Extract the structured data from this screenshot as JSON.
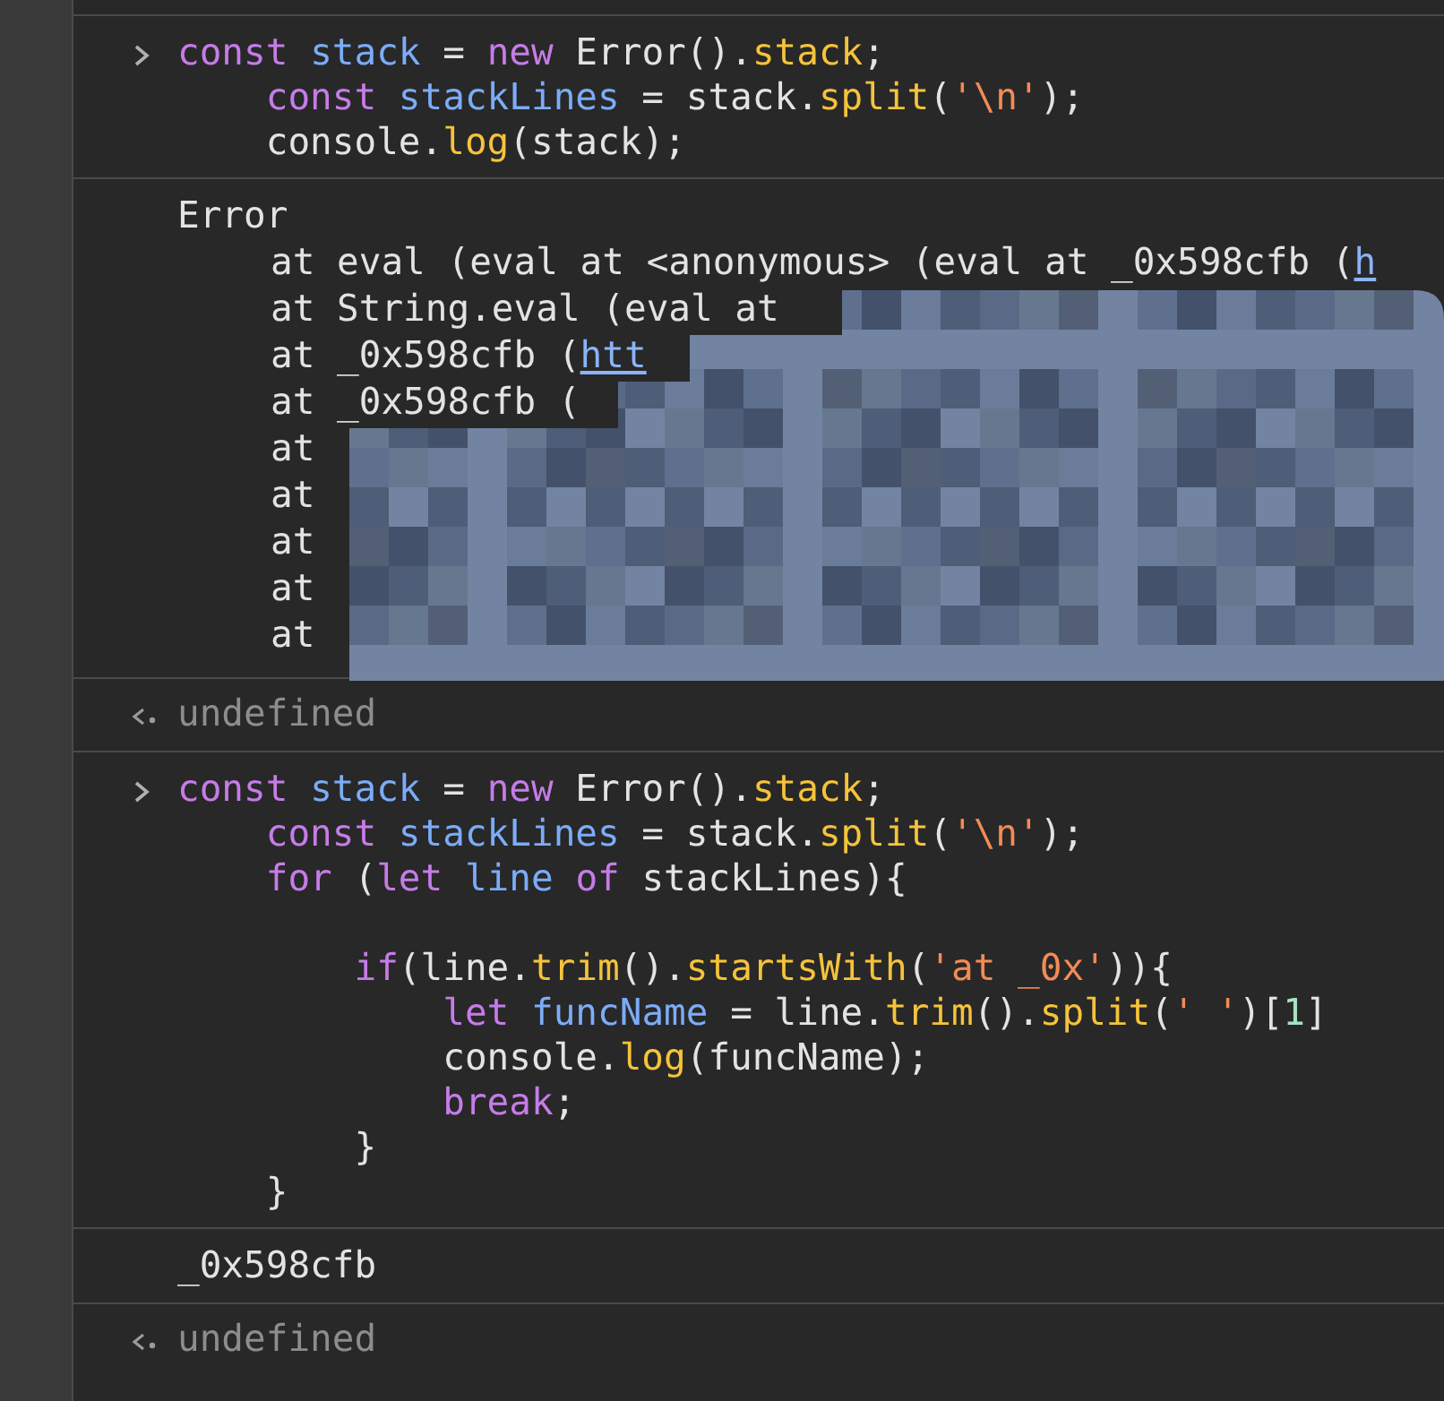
{
  "console": {
    "entries": [
      {
        "kind": "input",
        "lines": [
          {
            "tokens": [
              {
                "kind": "keyword",
                "text": "const "
              },
              {
                "kind": "variable",
                "text": "stack"
              },
              {
                "kind": "plain",
                "text": " = "
              },
              {
                "kind": "keyword",
                "text": "new"
              },
              {
                "kind": "plain",
                "text": " Error()."
              },
              {
                "kind": "function",
                "text": "stack"
              },
              {
                "kind": "plain",
                "text": ";"
              }
            ]
          },
          {
            "tokens": [
              {
                "kind": "keyword",
                "text": "    const "
              },
              {
                "kind": "variable",
                "text": "stackLines"
              },
              {
                "kind": "plain",
                "text": " = stack."
              },
              {
                "kind": "function",
                "text": "split"
              },
              {
                "kind": "plain",
                "text": "("
              },
              {
                "kind": "string",
                "text": "'\\n'"
              },
              {
                "kind": "plain",
                "text": ");"
              }
            ]
          },
          {
            "tokens": [
              {
                "kind": "plain",
                "text": "    console."
              },
              {
                "kind": "function",
                "text": "log"
              },
              {
                "kind": "plain",
                "text": "(stack);"
              }
            ]
          }
        ]
      },
      {
        "kind": "error",
        "lines": [
          {
            "kind": "message",
            "text": "Error"
          },
          {
            "kind": "frame",
            "text": "at eval (eval at <anonymous> (eval at _0x598cfb (",
            "link": "h"
          },
          {
            "kind": "frame",
            "text": "at String.eval (eval at"
          },
          {
            "kind": "frame",
            "text": "at _0x598cfb (",
            "link": "htt"
          },
          {
            "kind": "frame",
            "text": "at _0x598cfb ("
          },
          {
            "kind": "frame",
            "text": "at"
          },
          {
            "kind": "frame",
            "text": "at"
          },
          {
            "kind": "frame",
            "text": "at"
          },
          {
            "kind": "frame",
            "text": "at"
          },
          {
            "kind": "frame",
            "text": "at"
          }
        ],
        "redacted": true
      },
      {
        "kind": "return",
        "text": "undefined"
      },
      {
        "kind": "input",
        "lines": [
          {
            "tokens": [
              {
                "kind": "keyword",
                "text": "const "
              },
              {
                "kind": "variable",
                "text": "stack"
              },
              {
                "kind": "plain",
                "text": " = "
              },
              {
                "kind": "keyword",
                "text": "new"
              },
              {
                "kind": "plain",
                "text": " Error()."
              },
              {
                "kind": "function",
                "text": "stack"
              },
              {
                "kind": "plain",
                "text": ";"
              }
            ]
          },
          {
            "tokens": [
              {
                "kind": "keyword",
                "text": "    const "
              },
              {
                "kind": "variable",
                "text": "stackLines"
              },
              {
                "kind": "plain",
                "text": " = stack."
              },
              {
                "kind": "function",
                "text": "split"
              },
              {
                "kind": "plain",
                "text": "("
              },
              {
                "kind": "string",
                "text": "'\\n'"
              },
              {
                "kind": "plain",
                "text": ");"
              }
            ]
          },
          {
            "tokens": [
              {
                "kind": "keyword",
                "text": "    for"
              },
              {
                "kind": "plain",
                "text": " ("
              },
              {
                "kind": "keyword",
                "text": "let "
              },
              {
                "kind": "variable",
                "text": "line "
              },
              {
                "kind": "keyword",
                "text": "of"
              },
              {
                "kind": "plain",
                "text": " stackLines){"
              }
            ]
          },
          {
            "blank_before": true,
            "tokens": [
              {
                "kind": "keyword",
                "text": "        if"
              },
              {
                "kind": "plain",
                "text": "(line."
              },
              {
                "kind": "function",
                "text": "trim"
              },
              {
                "kind": "plain",
                "text": "()."
              },
              {
                "kind": "function",
                "text": "startsWith"
              },
              {
                "kind": "plain",
                "text": "("
              },
              {
                "kind": "string",
                "text": "'at _0x'"
              },
              {
                "kind": "plain",
                "text": ")){"
              }
            ]
          },
          {
            "tokens": [
              {
                "kind": "keyword",
                "text": "            let "
              },
              {
                "kind": "variable",
                "text": "funcName"
              },
              {
                "kind": "plain",
                "text": " = line."
              },
              {
                "kind": "function",
                "text": "trim"
              },
              {
                "kind": "plain",
                "text": "()."
              },
              {
                "kind": "function",
                "text": "split"
              },
              {
                "kind": "plain",
                "text": "("
              },
              {
                "kind": "string",
                "text": "' '"
              },
              {
                "kind": "plain",
                "text": ")["
              },
              {
                "kind": "number",
                "text": "1"
              },
              {
                "kind": "plain",
                "text": "]"
              }
            ]
          },
          {
            "tokens": [
              {
                "kind": "plain",
                "text": "            console."
              },
              {
                "kind": "function",
                "text": "log"
              },
              {
                "kind": "plain",
                "text": "(funcName);"
              }
            ]
          },
          {
            "tokens": [
              {
                "kind": "keyword",
                "text": "            break"
              },
              {
                "kind": "plain",
                "text": ";"
              }
            ]
          },
          {
            "tokens": [
              {
                "kind": "plain",
                "text": "        }"
              }
            ]
          },
          {
            "tokens": [
              {
                "kind": "plain",
                "text": "    }"
              }
            ]
          }
        ]
      },
      {
        "kind": "log",
        "text": "_0x598cfb"
      },
      {
        "kind": "return",
        "text": "undefined"
      }
    ]
  }
}
